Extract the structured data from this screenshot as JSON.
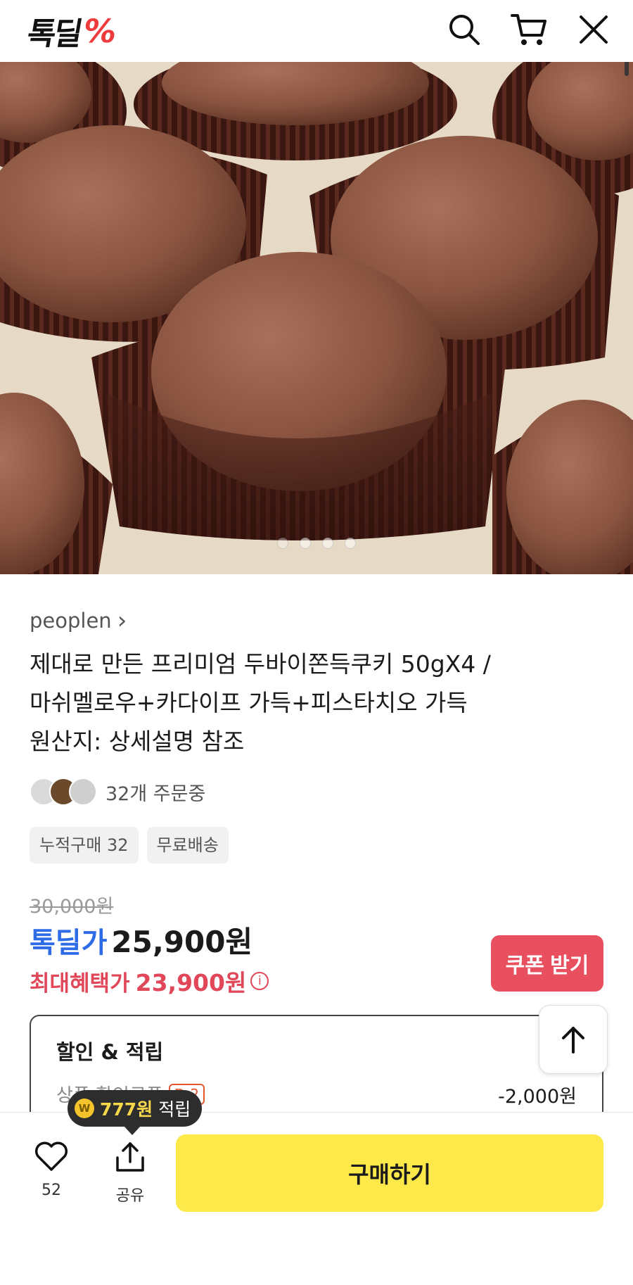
{
  "header": {
    "logo_text": "톡딜",
    "logo_mark": "%",
    "icons": [
      "search-icon",
      "cart-icon",
      "close-icon"
    ]
  },
  "hero": {
    "image_count": 4,
    "active_index": 0
  },
  "product": {
    "seller": "peoplen",
    "seller_arrow": "›",
    "title_line1": "제대로 만든 프리미엄 두바이쫀득쿠키 50gX4 /",
    "title_line2": "마쉬멜로우+카다이프 가득+피스타치오 가득",
    "title_line3": "원산지: 상세설명 참조",
    "ordering_text": "32개 주문중",
    "chips": [
      "누적구매 32",
      "무료배송"
    ]
  },
  "price": {
    "original": "30,000원",
    "deal_label": "톡딜가",
    "deal_price": "25,900원",
    "max_label": "최대혜택가",
    "max_price": "23,900원",
    "info_glyph": "i",
    "coupon_button": "쿠폰 받기"
  },
  "discount": {
    "title": "할인 & 적립",
    "line_label": "상품 할인쿠폰",
    "dday": "D-2",
    "amount": "-2,000원"
  },
  "bottom_bar": {
    "like_count": "52",
    "share_label": "공유",
    "buy_label": "구매하기",
    "reward_coin": "W",
    "reward_amount": "777원",
    "reward_label": "적립"
  },
  "colors": {
    "brand_red": "#ef3b3b",
    "deal_blue": "#2e6be6",
    "benefit_red": "#e0485a",
    "buy_yellow": "#fde94a"
  }
}
